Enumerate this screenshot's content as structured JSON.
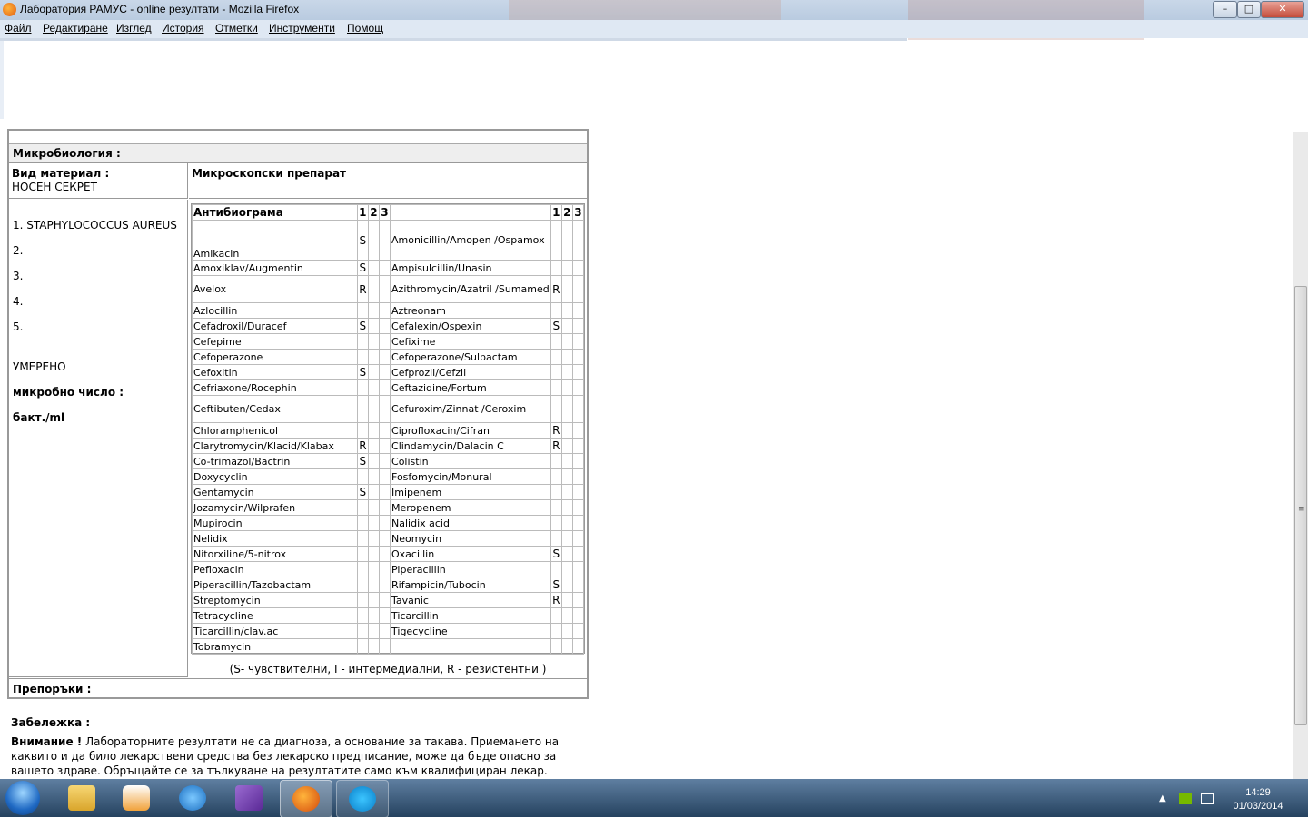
{
  "window": {
    "title": "Лаборатория РАМУС - online резултати - Mozilla Firefox",
    "buttons": {
      "minimize": "–",
      "maximize": "□",
      "close": "✕"
    }
  },
  "menu": [
    "Файл",
    "Редактиране",
    "Изглед",
    "История",
    "Отметки",
    "Инструменти",
    "Помощ"
  ],
  "report": {
    "section_title": "Микробиология :",
    "material_label": "Вид материал :",
    "material_value": "НОСЕН СЕКРЕТ",
    "preparation_label": "Микроскопски препарат",
    "organisms": [
      "1. STAPHYLOCOCCUS AUREUS",
      "2.",
      "3.",
      "4.",
      "5."
    ],
    "growth": "УМЕРЕНО",
    "count_label": "микробно число :",
    "count_unit": "бакт./ml",
    "antibiogram_title": "Антибиограма",
    "col_headers": [
      "1",
      "2",
      "3"
    ],
    "left_rows": [
      {
        "name": "Amikacin",
        "v1": "S"
      },
      {
        "name": "Amoxiklav/Augmentin",
        "v1": "S"
      },
      {
        "name": "Avelox",
        "v1": "R"
      },
      {
        "name": "Azlocillin",
        "v1": ""
      },
      {
        "name": "Cefadroxil/Duracef",
        "v1": "S"
      },
      {
        "name": "Cefepime",
        "v1": ""
      },
      {
        "name": "Cefoperazone",
        "v1": ""
      },
      {
        "name": "Cefoxitin",
        "v1": "S"
      },
      {
        "name": "Cefriaxone/Rocephin",
        "v1": ""
      },
      {
        "name": "Ceftibuten/Cedax",
        "v1": ""
      },
      {
        "name": "Chloramphenicol",
        "v1": ""
      },
      {
        "name": "Clarytromycin/Klacid/Klabax",
        "v1": "R"
      },
      {
        "name": "Co-trimazol/Bactrin",
        "v1": "S"
      },
      {
        "name": "Doxycyclin",
        "v1": ""
      },
      {
        "name": "Gentamycin",
        "v1": "S"
      },
      {
        "name": "Jozamycin/Wilprafen",
        "v1": ""
      },
      {
        "name": "Mupirocin",
        "v1": ""
      },
      {
        "name": "Nelidix",
        "v1": ""
      },
      {
        "name": "Nitorxiline/5-nitrox",
        "v1": ""
      },
      {
        "name": "Pefloxacin",
        "v1": ""
      },
      {
        "name": "Piperacillin/Tazobactam",
        "v1": ""
      },
      {
        "name": "Streptomycin",
        "v1": ""
      },
      {
        "name": "Tetracycline",
        "v1": ""
      },
      {
        "name": "Ticarcillin/clav.ac",
        "v1": ""
      },
      {
        "name": "Tobramycin",
        "v1": ""
      }
    ],
    "right_rows": [
      {
        "name": "Amonicillin/Amopen /Ospamox",
        "v1": ""
      },
      {
        "name": "Ampisulcillin/Unasin",
        "v1": ""
      },
      {
        "name": "Azithromycin/Azatril /Sumamed",
        "v1": "R"
      },
      {
        "name": "Aztreonam",
        "v1": ""
      },
      {
        "name": "Cefalexin/Ospexin",
        "v1": "S"
      },
      {
        "name": "Cefixime",
        "v1": ""
      },
      {
        "name": "Cefoperazone/Sulbactam",
        "v1": ""
      },
      {
        "name": "Cefprozil/Cefzil",
        "v1": ""
      },
      {
        "name": "Ceftazidine/Fortum",
        "v1": ""
      },
      {
        "name": "Cefuroxim/Zinnat /Ceroxim",
        "v1": ""
      },
      {
        "name": "Ciprofloxacin/Cifran",
        "v1": "R"
      },
      {
        "name": "Clindamycin/Dalacin C",
        "v1": "R"
      },
      {
        "name": "Colistin",
        "v1": ""
      },
      {
        "name": "Fosfomycin/Monural",
        "v1": ""
      },
      {
        "name": "Imipenem",
        "v1": ""
      },
      {
        "name": "Meropenem",
        "v1": ""
      },
      {
        "name": "Nalidix acid",
        "v1": ""
      },
      {
        "name": "Neomycin",
        "v1": ""
      },
      {
        "name": "Oxacillin",
        "v1": "S"
      },
      {
        "name": "Piperacillin",
        "v1": ""
      },
      {
        "name": "Rifampicin/Tubocin",
        "v1": "S"
      },
      {
        "name": "Tavanic",
        "v1": "R"
      },
      {
        "name": "Ticarcillin",
        "v1": ""
      },
      {
        "name": "Tigecycline",
        "v1": ""
      },
      {
        "name": "",
        "v1": ""
      }
    ],
    "legend": "(S- чувствителни, I - интермедиални, R - резистентни )",
    "recommendations_label": "Препоръки :"
  },
  "note": {
    "label": "Забележка :",
    "warning_label": "Внимание !",
    "warning_text": " Лабораторните резултати не са диагноза, а основание за такава. Приемането на каквито и да било лекарствени средства без лекарско предписание, може да бъде опасно за вашето здраве. Обръщайте се за тълкуване на резултатите само към квалифициран лекар."
  },
  "taskbar": {
    "time": "14:29",
    "date": "01/03/2014"
  }
}
